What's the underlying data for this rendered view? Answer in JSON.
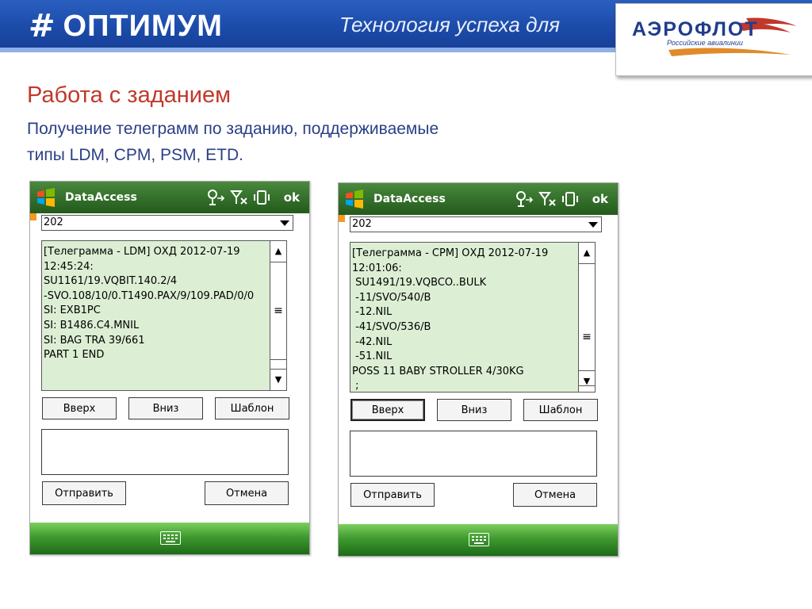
{
  "header": {
    "brand_mark": "#",
    "brand_name": "ОПТИМУМ",
    "slogan": "Технология успеха для",
    "partner_name": "АЭРОФЛОТ",
    "partner_sub": "Российские авиалинии"
  },
  "slide": {
    "title": "Работа с заданием",
    "subtitle_line1": "Получение телеграмм по заданию, поддерживаемые",
    "subtitle_line2": "типы LDM, CPM, PSM, ETD."
  },
  "screens": [
    {
      "app_title": "DataAccess",
      "ok_label": "ok",
      "dropdown_value": "202",
      "message_lines": [
        "[Телеграмма - LDM] ОХД 2012-07-19",
        "12:45:24:",
        "SU1161/19.VQBIT.140.2/4",
        "-SVO.108/10/0.T1490.PAX/9/109.PAD/0/0",
        "SI: EXB1PC",
        "SI: B1486.C4.MNIL",
        "SI: BAG TRA 39/661",
        "PART 1 END"
      ],
      "buttons": {
        "up": "Вверх",
        "down": "Вниз",
        "template": "Шаблон",
        "send": "Отправить",
        "cancel": "Отмена"
      }
    },
    {
      "app_title": "DataAccess",
      "ok_label": "ok",
      "dropdown_value": "202",
      "message_lines": [
        "[Телеграмма - CPM] ОХД 2012-07-19",
        "12:01:06:",
        " SU1491/19.VQBCO..BULK",
        " -11/SVO/540/B",
        " -12.NIL",
        " -41/SVO/536/B",
        " -42.NIL",
        " -51.NIL",
        "POSS 11 BABY STROLLER 4/30KG",
        " ;"
      ],
      "buttons": {
        "up": "Вверх",
        "down": "Вниз",
        "template": "Шаблон",
        "send": "Отправить",
        "cancel": "Отмена"
      }
    }
  ],
  "colors": {
    "banner_blue": "#1b4aa8",
    "title_red": "#c0392b",
    "subtitle_navy": "#2a3f86",
    "message_green": "#dcefd4",
    "titlebar_green": "#3c7a32"
  }
}
